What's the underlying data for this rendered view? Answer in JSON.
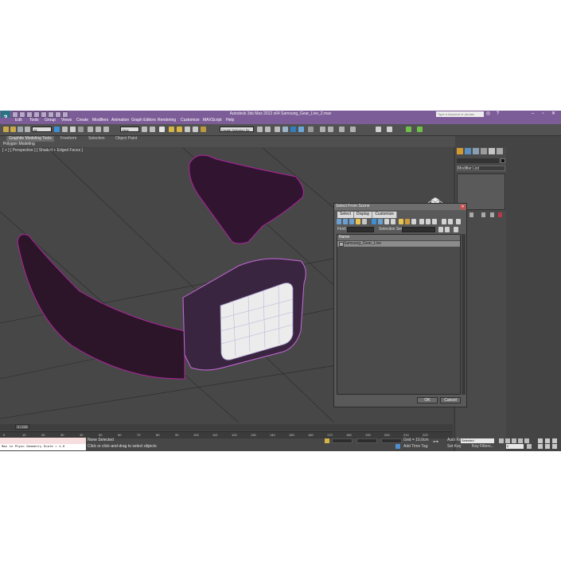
{
  "window": {
    "title": "Autodesk 3ds Max 2012 x64     Samsung_Gear_Live_2.max",
    "search_placeholder": "Type a keyword or phrase",
    "logo": "3"
  },
  "menu": [
    "Edit",
    "Tools",
    "Group",
    "Views",
    "Create",
    "Modifiers",
    "Animation",
    "Graph Editors",
    "Rendering",
    "Customize",
    "MAXScript",
    "Help"
  ],
  "toolbar": {
    "selection_filter": "All",
    "ref_coord": "View",
    "named_selection": "Create Selection Se"
  },
  "ribbon": {
    "tabs": [
      "Graphite Modeling Tools",
      "Freeform",
      "Selection",
      "Object Paint"
    ],
    "active_tab": "Graphite Modeling Tools",
    "subtitle": "Polygon Modeling"
  },
  "viewport": {
    "label": "[ + ] [ Perspective ] [ Shaded + Edged Faces ]"
  },
  "command_panel": {
    "modifier_list": "Modifier List"
  },
  "dialog": {
    "title": "Select From Scene",
    "menu": [
      "Select",
      "Display",
      "Customize"
    ],
    "find_label": "Find:",
    "selection_set_label": "Selection Set:",
    "column_header": "Name",
    "rows": [
      "Samsung_Gear_Live"
    ],
    "ok_label": "OK",
    "cancel_label": "Cancel"
  },
  "timeline": {
    "slider_label": "0 / 225",
    "ticks": [
      "0",
      "10",
      "20",
      "30",
      "40",
      "50",
      "60",
      "70",
      "80",
      "90",
      "100",
      "110",
      "120",
      "130",
      "140",
      "150",
      "160",
      "170",
      "180",
      "190",
      "200",
      "210",
      "220"
    ]
  },
  "status": {
    "maxscript_output": "Max to Physc Geometry Scale = 1.0",
    "selection_status": "None Selected",
    "prompt": "Click or click-and-drag to select objects",
    "grid": "Grid = 10,0cm",
    "auto_key": "Auto Key",
    "selected_dropdown": "Selected",
    "set_key": "Set Key",
    "key_filters": "Key Filters...",
    "add_time_tag": "Add Time Tag",
    "frame_value": "0"
  }
}
